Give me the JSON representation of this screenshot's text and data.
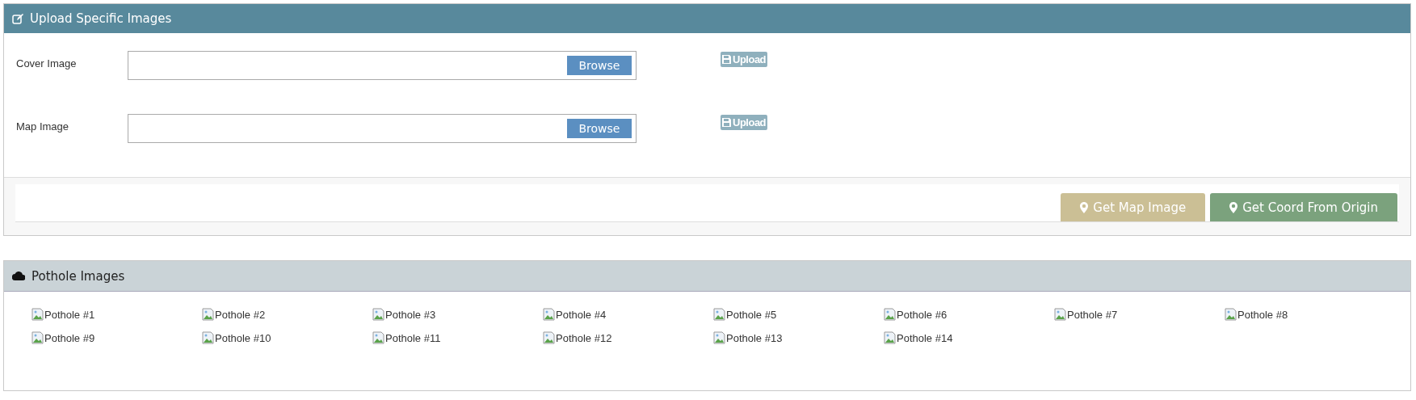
{
  "upload_panel": {
    "title": "Upload Specific Images",
    "fields": [
      {
        "label": "Cover Image",
        "browse": "Browse",
        "upload": "Upload",
        "disabled": true
      },
      {
        "label": "Map Image",
        "browse": "Browse",
        "upload": "Upload",
        "disabled": true
      }
    ],
    "actions": [
      {
        "label": "Get Map Image",
        "color": "#cbbf95"
      },
      {
        "label": "Get Coord From Origin",
        "color": "#7ba27d"
      }
    ]
  },
  "pothole_panel": {
    "title": "Pothole Images",
    "images": [
      "Pothole #1",
      "Pothole #2",
      "Pothole #3",
      "Pothole #4",
      "Pothole #5",
      "Pothole #6",
      "Pothole #7",
      "Pothole #8",
      "Pothole #9",
      "Pothole #10",
      "Pothole #11",
      "Pothole #12",
      "Pothole #13",
      "Pothole #14"
    ]
  }
}
